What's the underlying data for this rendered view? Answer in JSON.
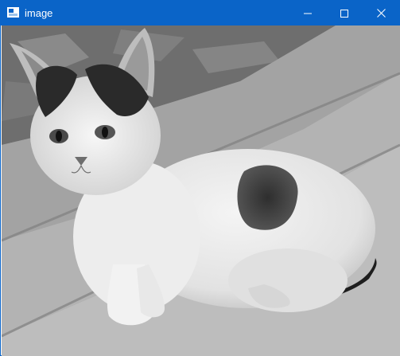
{
  "window": {
    "title": "image",
    "accent_color": "#0a64c8",
    "icons": {
      "app": "image-window-icon",
      "minimize": "minimize-icon",
      "maximize": "maximize-icon",
      "close": "close-icon"
    }
  },
  "image": {
    "subject": "photograph",
    "color_mode": "grayscale"
  }
}
